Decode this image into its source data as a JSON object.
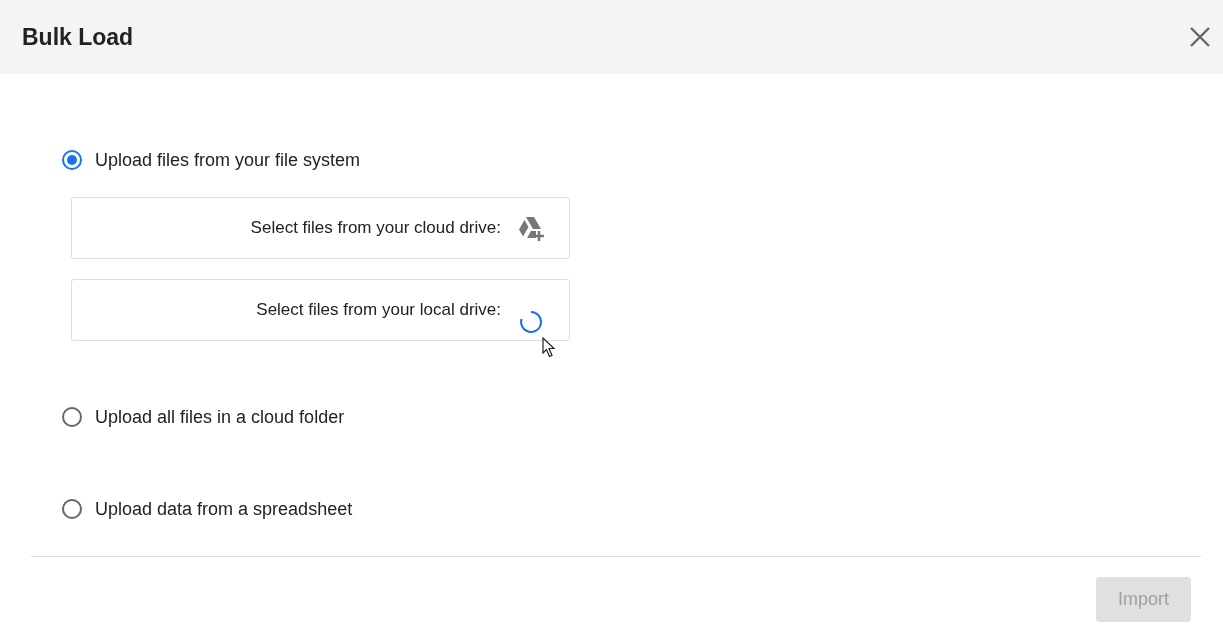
{
  "dialog": {
    "title": "Bulk Load"
  },
  "options": [
    {
      "label": "Upload files from your file system",
      "selected": true,
      "sources": [
        {
          "label": "Select files from your cloud drive:",
          "kind": "cloud"
        },
        {
          "label": "Select files from your local drive:",
          "kind": "loading"
        }
      ]
    },
    {
      "label": "Upload all files in a cloud folder",
      "selected": false
    },
    {
      "label": "Upload data from a spreadsheet",
      "selected": false
    }
  ],
  "footer": {
    "button": {
      "label": "Import",
      "disabled": true
    }
  }
}
